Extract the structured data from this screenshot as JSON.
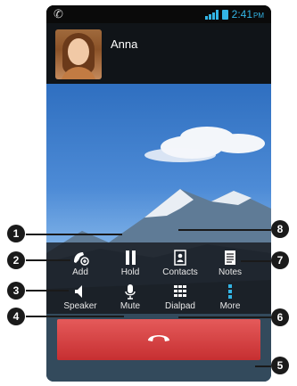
{
  "status": {
    "time": "2:41",
    "ampm": "PM",
    "left_icon": "phone-icon"
  },
  "caller": {
    "name": "Anna"
  },
  "controls": {
    "add": "Add",
    "hold": "Hold",
    "contacts": "Contacts",
    "notes": "Notes",
    "speaker": "Speaker",
    "mute": "Mute",
    "dialpad": "Dialpad",
    "more": "More"
  },
  "callouts": [
    "1",
    "2",
    "3",
    "4",
    "5",
    "6",
    "7",
    "8"
  ],
  "colors": {
    "accent": "#33b5e5",
    "end_call": "#d23a3c"
  }
}
